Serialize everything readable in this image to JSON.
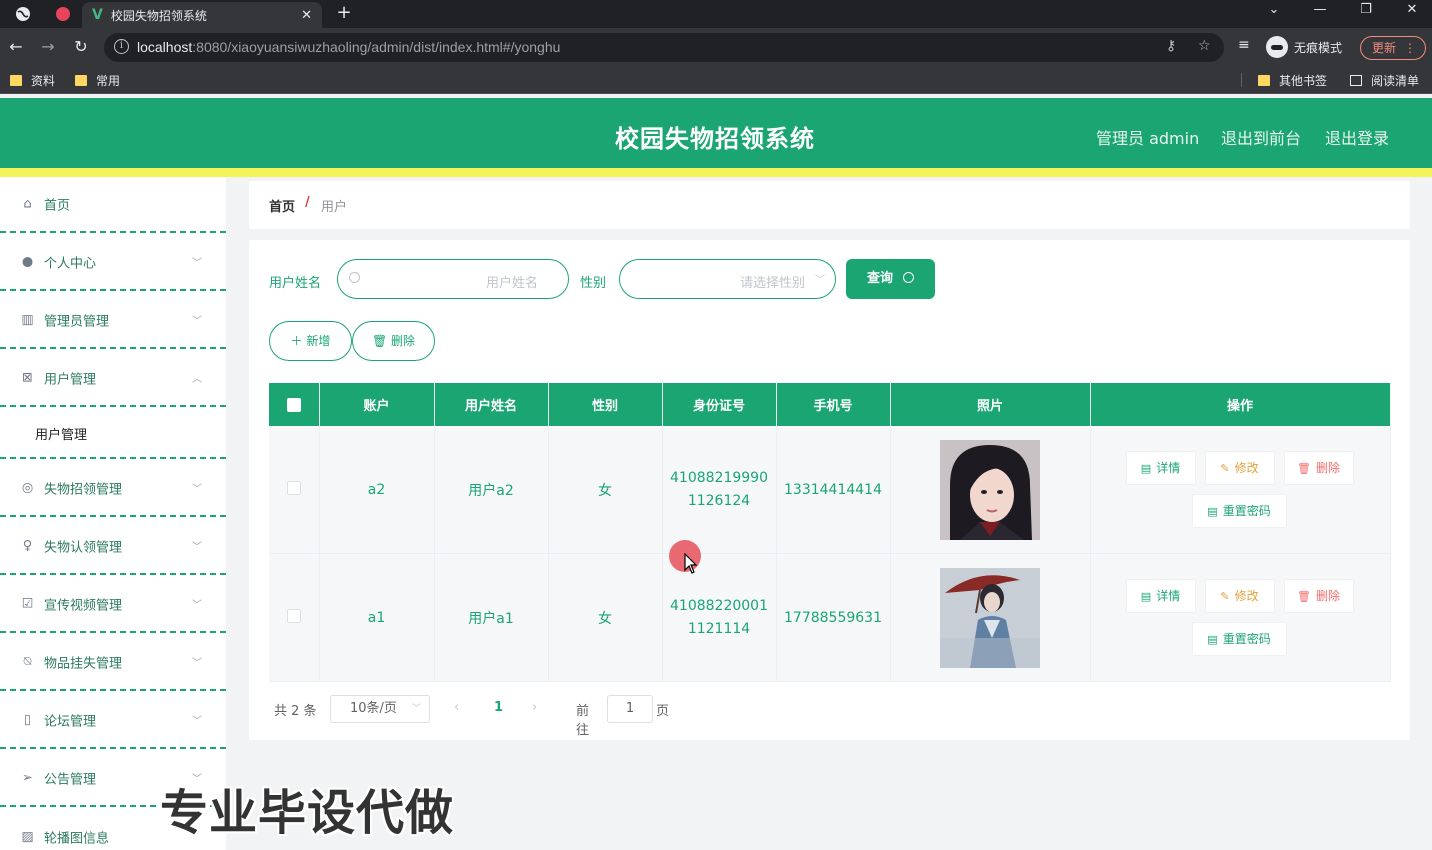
{
  "browser": {
    "tab_title": "校园失物招领系统",
    "url_host": "localhost",
    "url_rest": ":8080/xiaoyuansiwuzhaoling/admin/dist/index.html#/yonghu",
    "incognito_label": "无痕模式",
    "update_label": "更新",
    "bookmarks": [
      "资料",
      "常用"
    ],
    "other_bookmarks": "其他书签",
    "reading_list": "阅读清单"
  },
  "header": {
    "title": "校园失物招领系统",
    "user": "管理员 admin",
    "to_front": "退出到前台",
    "logout": "退出登录"
  },
  "sidebar": {
    "items": [
      {
        "label": "首页",
        "icon": "home-icon"
      },
      {
        "label": "个人中心",
        "icon": "user-icon"
      },
      {
        "label": "管理员管理",
        "icon": "books-icon"
      },
      {
        "label": "用户管理",
        "icon": "box-icon"
      },
      {
        "label": "用户管理"
      },
      {
        "label": "失物招领管理",
        "icon": "target-icon"
      },
      {
        "label": "失物认领管理",
        "icon": "microphone-icon"
      },
      {
        "label": "宣传视频管理",
        "icon": "checkbox-icon"
      },
      {
        "label": "物品挂失管理",
        "icon": "bell-off-icon"
      },
      {
        "label": "论坛管理",
        "icon": "phone-icon"
      },
      {
        "label": "公告管理",
        "icon": "send-icon"
      },
      {
        "label": "轮播图信息",
        "icon": "picture-icon"
      }
    ]
  },
  "breadcrumb": {
    "home": "首页",
    "separator": "/",
    "current": "用户"
  },
  "search": {
    "name_label": "用户姓名",
    "name_placeholder": "用户姓名",
    "gender_label": "性别",
    "gender_placeholder": "请选择性别",
    "query_button": "查询"
  },
  "actions": {
    "add": "新增",
    "delete": "删除"
  },
  "table": {
    "columns": [
      "账户",
      "用户姓名",
      "性别",
      "身份证号",
      "手机号",
      "照片",
      "操作"
    ],
    "rows": [
      {
        "account": "a2",
        "name": "用户a2",
        "gender": "女",
        "id_line1": "41088219990",
        "id_line2": "1126124",
        "phone": "13314414414"
      },
      {
        "account": "a1",
        "name": "用户a1",
        "gender": "女",
        "id_line1": "41088220001",
        "id_line2": "1121114",
        "phone": "17788559631"
      }
    ],
    "row_actions": {
      "detail": "详情",
      "edit": "修改",
      "delete": "删除",
      "reset": "重置密码"
    }
  },
  "pagination": {
    "total": "共 2 条",
    "page_size": "10条/页",
    "current_page": "1",
    "goto_label": "前往",
    "goto_value": "1",
    "page_suffix": "页"
  },
  "watermark": "专业毕设代做",
  "colors": {
    "primary": "#1ba573",
    "accent_band": "#f3f35a",
    "danger": "#f56c6c",
    "warning": "#e6a23c"
  }
}
